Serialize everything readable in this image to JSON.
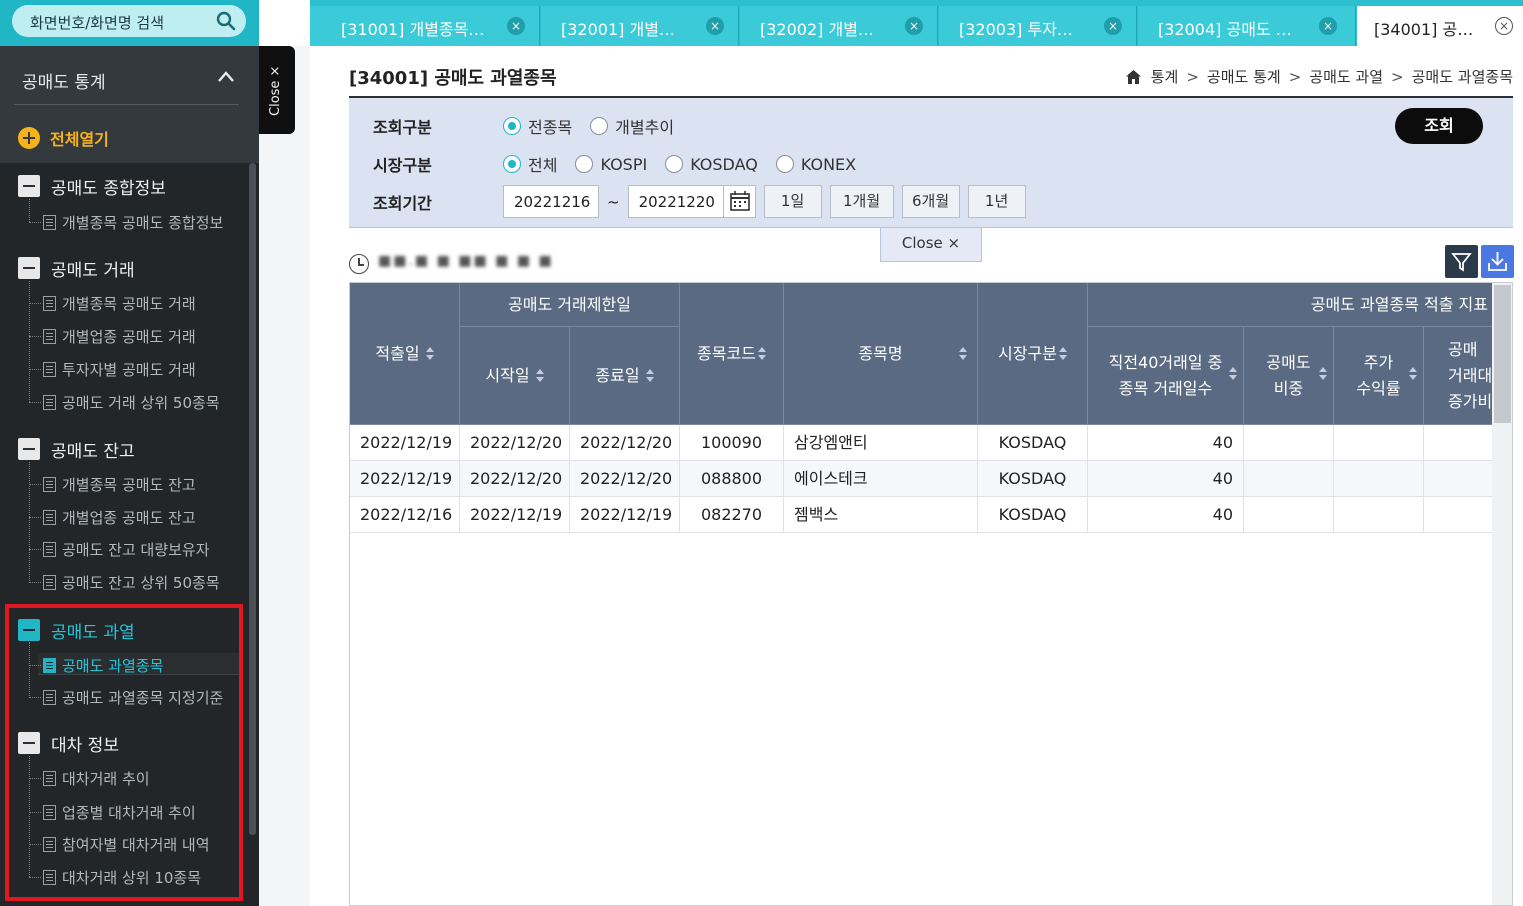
{
  "sidebar": {
    "search_placeholder": "화면번호/화면명 검색",
    "title": "공매도 통계",
    "expand_all": "전체열기",
    "groups": [
      {
        "label": "공매도 종합정보",
        "items": [
          "개별종목 공매도 종합정보"
        ]
      },
      {
        "label": "공매도 거래",
        "items": [
          "개별종목 공매도 거래",
          "개별업종 공매도 거래",
          "투자자별 공매도 거래",
          "공매도 거래 상위 50종목"
        ]
      },
      {
        "label": "공매도 잔고",
        "items": [
          "개별종목 공매도 잔고",
          "개별업종 공매도 잔고",
          "공매도 잔고 대량보유자",
          "공매도 잔고 상위 50종목"
        ]
      },
      {
        "label": "공매도 과열",
        "items": [
          "공매도 과열종목",
          "공매도 과열종목 지정기준"
        ]
      },
      {
        "label": "대차 정보",
        "items": [
          "대차거래 추이",
          "업종별 대차거래 추이",
          "참여자별 대차거래 내역",
          "대차거래 상위 10종목"
        ]
      }
    ],
    "close_label": "Close ×"
  },
  "tabs": [
    {
      "label": "[31001] 개별종목…",
      "close": "×"
    },
    {
      "label": "[32001] 개별…",
      "close": "×"
    },
    {
      "label": "[32002] 개별…",
      "close": "×"
    },
    {
      "label": "[32003] 투자…",
      "close": "×"
    },
    {
      "label": "[32004] 공매도 …",
      "close": "×"
    },
    {
      "label": "[34001] 공…",
      "close": "×"
    }
  ],
  "page": {
    "title": "[34001] 공매도 과열종목",
    "breadcrumb": [
      "통계",
      "공매도 통계",
      "공매도 과열",
      "공매도 과열종목"
    ],
    "breadcrumb_sep": ">"
  },
  "search": {
    "row1_label": "조회구분",
    "row1_options": [
      "전종목",
      "개별추이"
    ],
    "row2_label": "시장구분",
    "row2_options": [
      "전체",
      "KOSPI",
      "KOSDAQ",
      "KONEX"
    ],
    "row3_label": "조회기간",
    "start_date": "20221216",
    "tilde": "~",
    "end_date": "20221220",
    "periods": [
      "1일",
      "1개월",
      "6개월",
      "1년"
    ],
    "button": "조회",
    "panel_close": "Close ×"
  },
  "toolbar": {
    "timestamp_blurred": "■■.■ ■ ■■ ■ ■ ■",
    "filter_icon": "filter-icon",
    "download_icon": "download-icon"
  },
  "table": {
    "headers": {
      "date": "적출일",
      "restrict_group": "공매도 거래제한일",
      "start": "시작일",
      "end": "종료일",
      "code": "종목코드",
      "name": "종목명",
      "market": "시장구분",
      "indicator_group": "공매도 과열종목 적출 지표",
      "days40_l1": "직전40거래일 중",
      "days40_l2": "종목 거래일수",
      "ratio_l1": "공매도",
      "ratio_l2": "비중",
      "ret_l1": "주가",
      "ret_l2": "수익률",
      "amt_l1": "공매",
      "amt_l2": "거래대",
      "amt_l3": "증가비"
    },
    "rows": [
      {
        "date": "2022/12/19",
        "start": "2022/12/20",
        "end": "2022/12/20",
        "code": "100090",
        "name": "삼강엠앤티",
        "market": "KOSDAQ",
        "days": "40"
      },
      {
        "date": "2022/12/19",
        "start": "2022/12/20",
        "end": "2022/12/20",
        "code": "088800",
        "name": "에이스테크",
        "market": "KOSDAQ",
        "days": "40"
      },
      {
        "date": "2022/12/16",
        "start": "2022/12/19",
        "end": "2022/12/19",
        "code": "082270",
        "name": "젬백스",
        "market": "KOSDAQ",
        "days": "40"
      }
    ]
  },
  "colors": {
    "accent": "#21b6c6",
    "sidebar_bg": "#222629",
    "header_bg": "#5a6a82",
    "highlight": "#e0181f",
    "expand_all": "#f6b21b"
  }
}
